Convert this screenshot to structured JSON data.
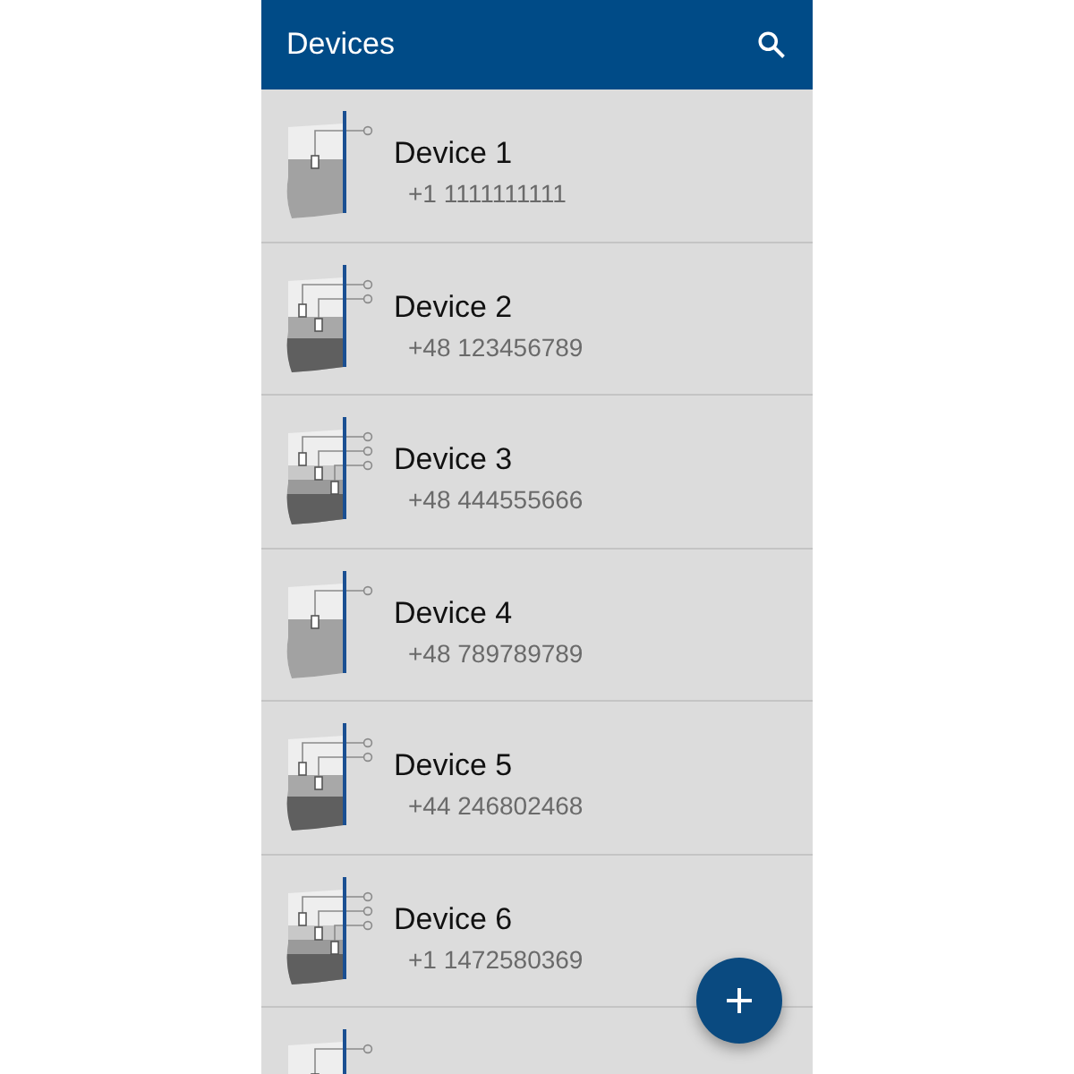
{
  "app_bar": {
    "title": "Devices"
  },
  "devices": [
    {
      "kind": "single",
      "name": "Device 1",
      "phone": "+1 1111111111"
    },
    {
      "kind": "dual",
      "name": "Device 2",
      "phone": "+48 123456789"
    },
    {
      "kind": "triple",
      "name": "Device 3",
      "phone": "+48 444555666"
    },
    {
      "kind": "single",
      "name": "Device 4",
      "phone": "+48 789789789"
    },
    {
      "kind": "dual",
      "name": "Device 5",
      "phone": "+44 246802468"
    },
    {
      "kind": "triple",
      "name": "Device 6",
      "phone": "+1 1472580369"
    },
    {
      "kind": "single"
    }
  ]
}
